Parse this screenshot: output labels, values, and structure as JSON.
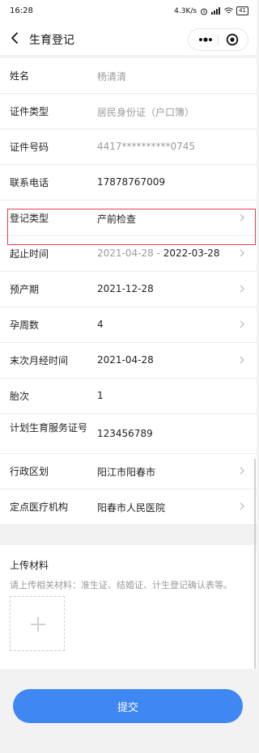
{
  "status_bar": {
    "time": "16:28",
    "net_speed": "4.3K/s",
    "battery": "41"
  },
  "nav": {
    "title": "生育登记"
  },
  "form": {
    "rows": [
      {
        "label": "姓名",
        "value": "杨清清"
      },
      {
        "label": "证件类型",
        "value": "居民身份证（户口簿）"
      },
      {
        "label": "证件号码",
        "value": "4417**********0745"
      },
      {
        "label": "联系电话",
        "value": "17878767009"
      },
      {
        "label": "登记类型",
        "value": "产前检查"
      },
      {
        "label": "起止时间",
        "start": "2021-04-28",
        "dash": "-",
        "end": "2022-03-28"
      },
      {
        "label": "预产期",
        "value": "2021-12-28"
      },
      {
        "label": "孕周数",
        "value": "4"
      },
      {
        "label": "末次月经时间",
        "value": "2021-04-28"
      },
      {
        "label": "胎次",
        "value": "1"
      },
      {
        "label": "计划生育服务证号",
        "value": "123456789"
      },
      {
        "label": "行政区划",
        "value": "阳江市阳春市"
      },
      {
        "label": "定点医疗机构",
        "value": "阳春市人民医院"
      }
    ]
  },
  "upload": {
    "title": "上传材料",
    "hint": "请上传相关材料：准生证、结婚证、计生登记确认表等。"
  },
  "submit_label": "提交",
  "colors": {
    "accent": "#3f87f3",
    "highlight": "#e0414f",
    "background": "#f2f2f2"
  }
}
